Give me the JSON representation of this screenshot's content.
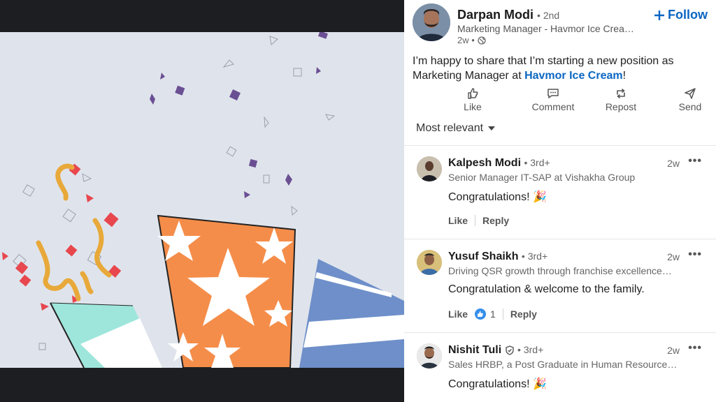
{
  "post": {
    "author": {
      "name": "Darpan Modi",
      "degree": "• 2nd",
      "headline": "Marketing Manager - Havmor Ice Crea…",
      "time": "2w •"
    },
    "follow_label": "Follow",
    "text_before": "I’m happy to share that I’m starting a new position as Marketing Manager at ",
    "company": "Havmor Ice Cream",
    "text_after": "!"
  },
  "actions": {
    "like": "Like",
    "comment": "Comment",
    "repost": "Repost",
    "send": "Send"
  },
  "sort_label": "Most relevant",
  "comments": [
    {
      "name": "Kalpesh Modi",
      "degree": "• 3rd+",
      "headline": "Senior Manager IT-SAP at Vishakha Group",
      "time": "2w",
      "text": "Congratulations! 🎉",
      "like": "Like",
      "reply": "Reply"
    },
    {
      "name": "Yusuf Shaikh",
      "degree": "• 3rd+",
      "headline": "Driving QSR growth through franchise excellence…",
      "time": "2w",
      "text": "Congratulation  & welcome to the family.",
      "like": "Like",
      "reaction_count": "1",
      "reply": "Reply"
    },
    {
      "name": "Nishit Tuli",
      "degree": "• 3rd+",
      "headline": "Sales HRBP, a Post Graduate in Human Resource…",
      "time": "2w",
      "text": "Congratulations! 🎉"
    }
  ],
  "colors": {
    "link": "#0a66c2",
    "canvas": "#dfe4ec",
    "orange_box": "#f58d4a",
    "teal_box": "#9ee6db",
    "blue_box": "#6e8fc9",
    "confetti_purple": "#6b4f93",
    "confetti_red": "#e8474e",
    "ribbon_gold": "#e8a93a"
  },
  "icons": [
    "globe-icon",
    "plus-icon",
    "like-icon",
    "comment-icon",
    "repost-icon",
    "send-icon",
    "caret-down-icon",
    "more-icon",
    "verified-icon",
    "celebrate-icon"
  ]
}
